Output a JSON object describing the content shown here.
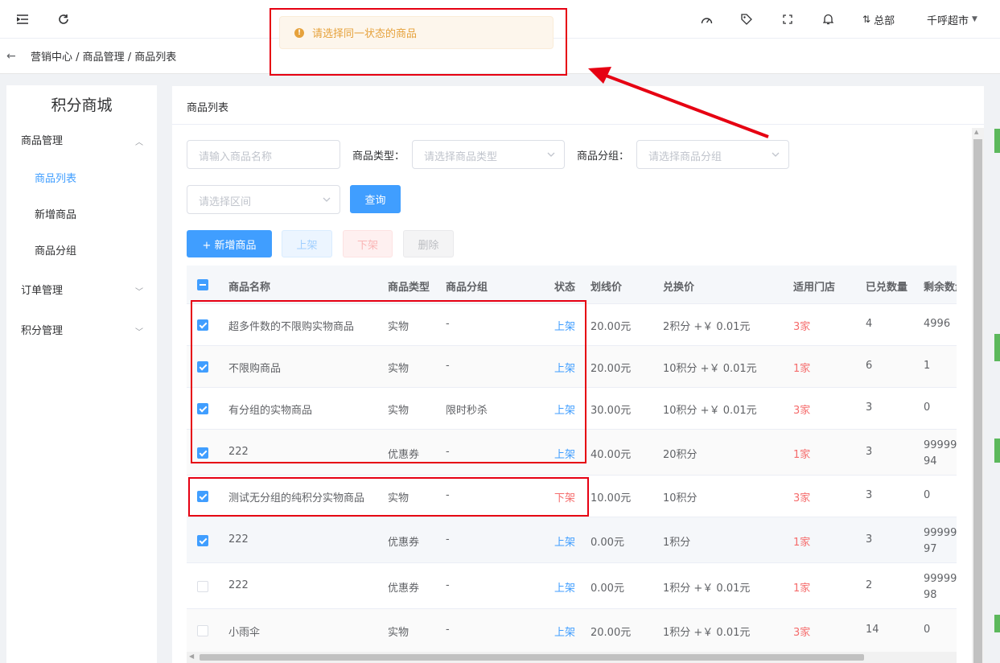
{
  "topbar": {
    "menu_icon": "menu-fold-icon",
    "refresh_icon": "refresh-icon",
    "right_icons": [
      "dashboard-icon",
      "tag-icon",
      "fullscreen-icon",
      "bell-icon"
    ],
    "branch_label": "总部",
    "store_label": "千呼超市"
  },
  "breadcrumb": {
    "path": "营销中心 / 商品管理 / 商品列表"
  },
  "toast": {
    "message": "请选择同一状态的商品",
    "color": "#e6a23c"
  },
  "sidebar": {
    "title": "积分商城",
    "groups": [
      {
        "label": "商品管理",
        "expanded": true,
        "items": [
          {
            "label": "商品列表",
            "active": true
          },
          {
            "label": "新增商品",
            "active": false
          },
          {
            "label": "商品分组",
            "active": false
          }
        ]
      },
      {
        "label": "订单管理",
        "expanded": false
      },
      {
        "label": "积分管理",
        "expanded": false
      }
    ]
  },
  "card": {
    "title": "商品列表"
  },
  "filters": {
    "name_placeholder": "请输入商品名称",
    "type_label": "商品类型：",
    "type_placeholder": "请选择商品类型",
    "group_label": "商品分组：",
    "group_placeholder": "请选择商品分组",
    "range_placeholder": "请选择区间",
    "query_label": "查询"
  },
  "actions": {
    "add_label": "+ 新增商品",
    "on_label": "上架",
    "off_label": "下架",
    "delete_label": "删除"
  },
  "table": {
    "columns": [
      "商品名称",
      "商品类型",
      "商品分组",
      "状态",
      "划线价",
      "兑换价",
      "适用门店",
      "已兑数量",
      "剩余数量"
    ],
    "rows": [
      {
        "checked": true,
        "name": "超多件数的不限购实物商品",
        "type": "实物",
        "group": "-",
        "status": "上架",
        "status_on": true,
        "list_price": "20.00元",
        "exchange": "2积分 +￥ 0.01元",
        "stores": "3家",
        "sold": "4",
        "remain": "4996"
      },
      {
        "checked": true,
        "name": "不限购商品",
        "type": "实物",
        "group": "-",
        "status": "上架",
        "status_on": true,
        "list_price": "20.00元",
        "exchange": "10积分 +￥ 0.01元",
        "stores": "1家",
        "sold": "6",
        "remain": "1"
      },
      {
        "checked": true,
        "name": "有分组的实物商品",
        "type": "实物",
        "group": "限时秒杀",
        "status": "上架",
        "status_on": true,
        "list_price": "30.00元",
        "exchange": "10积分 +￥ 0.01元",
        "stores": "3家",
        "sold": "3",
        "remain": "0"
      },
      {
        "checked": true,
        "name": "222",
        "type": "优惠券",
        "group": "-",
        "status": "上架",
        "status_on": true,
        "list_price": "40.00元",
        "exchange": "20积分",
        "stores": "1家",
        "sold": "3",
        "remain": "9999994"
      },
      {
        "checked": true,
        "name": "测试无分组的纯积分实物商品",
        "type": "实物",
        "group": "-",
        "status": "下架",
        "status_on": false,
        "list_price": "10.00元",
        "exchange": "10积分",
        "stores": "3家",
        "sold": "3",
        "remain": "0"
      },
      {
        "checked": true,
        "name": "222",
        "type": "优惠券",
        "group": "-",
        "status": "上架",
        "status_on": true,
        "list_price": "0.00元",
        "exchange": "1积分",
        "stores": "1家",
        "sold": "3",
        "remain": "9999997"
      },
      {
        "checked": false,
        "name": "222",
        "type": "优惠券",
        "group": "-",
        "status": "上架",
        "status_on": true,
        "list_price": "0.00元",
        "exchange": "1积分 +￥ 0.01元",
        "stores": "1家",
        "sold": "2",
        "remain": "9999998"
      },
      {
        "checked": false,
        "name": "小雨伞",
        "type": "实物",
        "group": "-",
        "status": "上架",
        "status_on": true,
        "list_price": "20.00元",
        "exchange": "1积分 +￥ 0.01元",
        "stores": "3家",
        "sold": "14",
        "remain": "0"
      }
    ]
  },
  "colors": {
    "primary": "#409eff",
    "danger": "#f56c6c",
    "annotation": "#e60012"
  }
}
